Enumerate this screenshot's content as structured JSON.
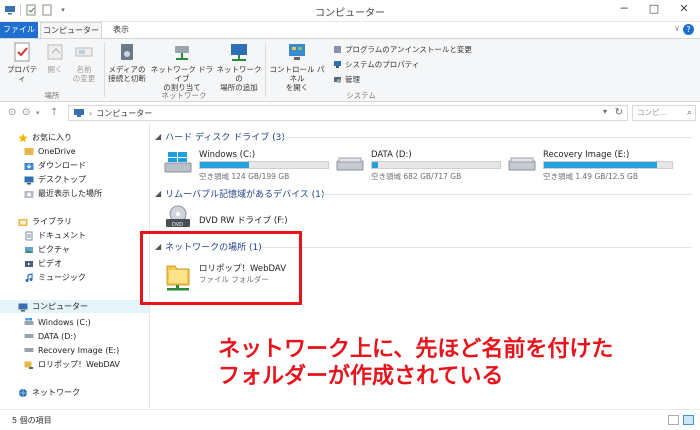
{
  "window": {
    "title": "コンピューター",
    "minimize": "─",
    "maximize": "□",
    "close": "✕"
  },
  "ribbon_tabs": {
    "file": "ファイル",
    "computer": "コンピューター",
    "view": "表示",
    "collapse": "∨",
    "help": "?"
  },
  "ribbon": {
    "properties": "プロパティ",
    "open": "開く",
    "rename_line1": "名前",
    "rename_line2": "の変更",
    "access_media_line1": "メディアの",
    "access_media_line2": "接続と切断",
    "map_drive_line1": "ネットワーク ドライブ",
    "map_drive_line2": "の割り当て",
    "add_location_line1": "ネットワークの",
    "add_location_line2": "場所の追加",
    "control_panel_line1": "コントロール パネル",
    "control_panel_line2": "を開く",
    "uninstall": "プログラムのアンインストールと変更",
    "system_properties": "システムのプロパティ",
    "manage": "管理",
    "group_location": "場所",
    "group_network": "ネットワーク",
    "group_system": "システム"
  },
  "address": {
    "path": "コンピューター",
    "search_placeholder": "コンピ..."
  },
  "nav": {
    "favorites": "お気に入り",
    "onedrive": "OneDrive",
    "downloads": "ダウンロード",
    "desktop": "デスクトップ",
    "recent": "最近表示した場所",
    "libraries": "ライブラリ",
    "documents": "ドキュメント",
    "pictures": "ピクチャ",
    "videos": "ビデオ",
    "music": "ミュージック",
    "computer": "コンピューター",
    "drive_c": "Windows (C:)",
    "drive_d": "DATA (D:)",
    "drive_e": "Recovery Image (E:)",
    "webdav": "ロリポップ！WebDAV",
    "network": "ネットワーク"
  },
  "sections": {
    "hard_drives": "ハード ディスク ドライブ (3)",
    "removable": "リムーバブル記憶域があるデバイス (1)",
    "network_locations": "ネットワークの場所 (1)"
  },
  "drives": [
    {
      "name": "Windows (C:)",
      "free": "空き領域 124 GB/199 GB",
      "used_fraction": 0.38
    },
    {
      "name": "DATA (D:)",
      "free": "空き領域 682 GB/717 GB",
      "used_fraction": 0.05
    },
    {
      "name": "Recovery Image (E:)",
      "free": "空き領域 1.49 GB/12.5 GB",
      "used_fraction": 0.88
    }
  ],
  "dvd": {
    "name": "DVD RW ドライブ (F:)"
  },
  "network_item": {
    "name": "ロリポップ！WebDAV",
    "type": "ファイル フォルダー"
  },
  "annotation": "ネットワーク上に、先ほど名前を付けた\nフォルダーが作成されている",
  "status": {
    "item_count": "5 個の項目"
  },
  "colors": {
    "accent": "#1f6fcf",
    "drive_bar": "#26a0da",
    "annotation_red": "#e8141c"
  }
}
